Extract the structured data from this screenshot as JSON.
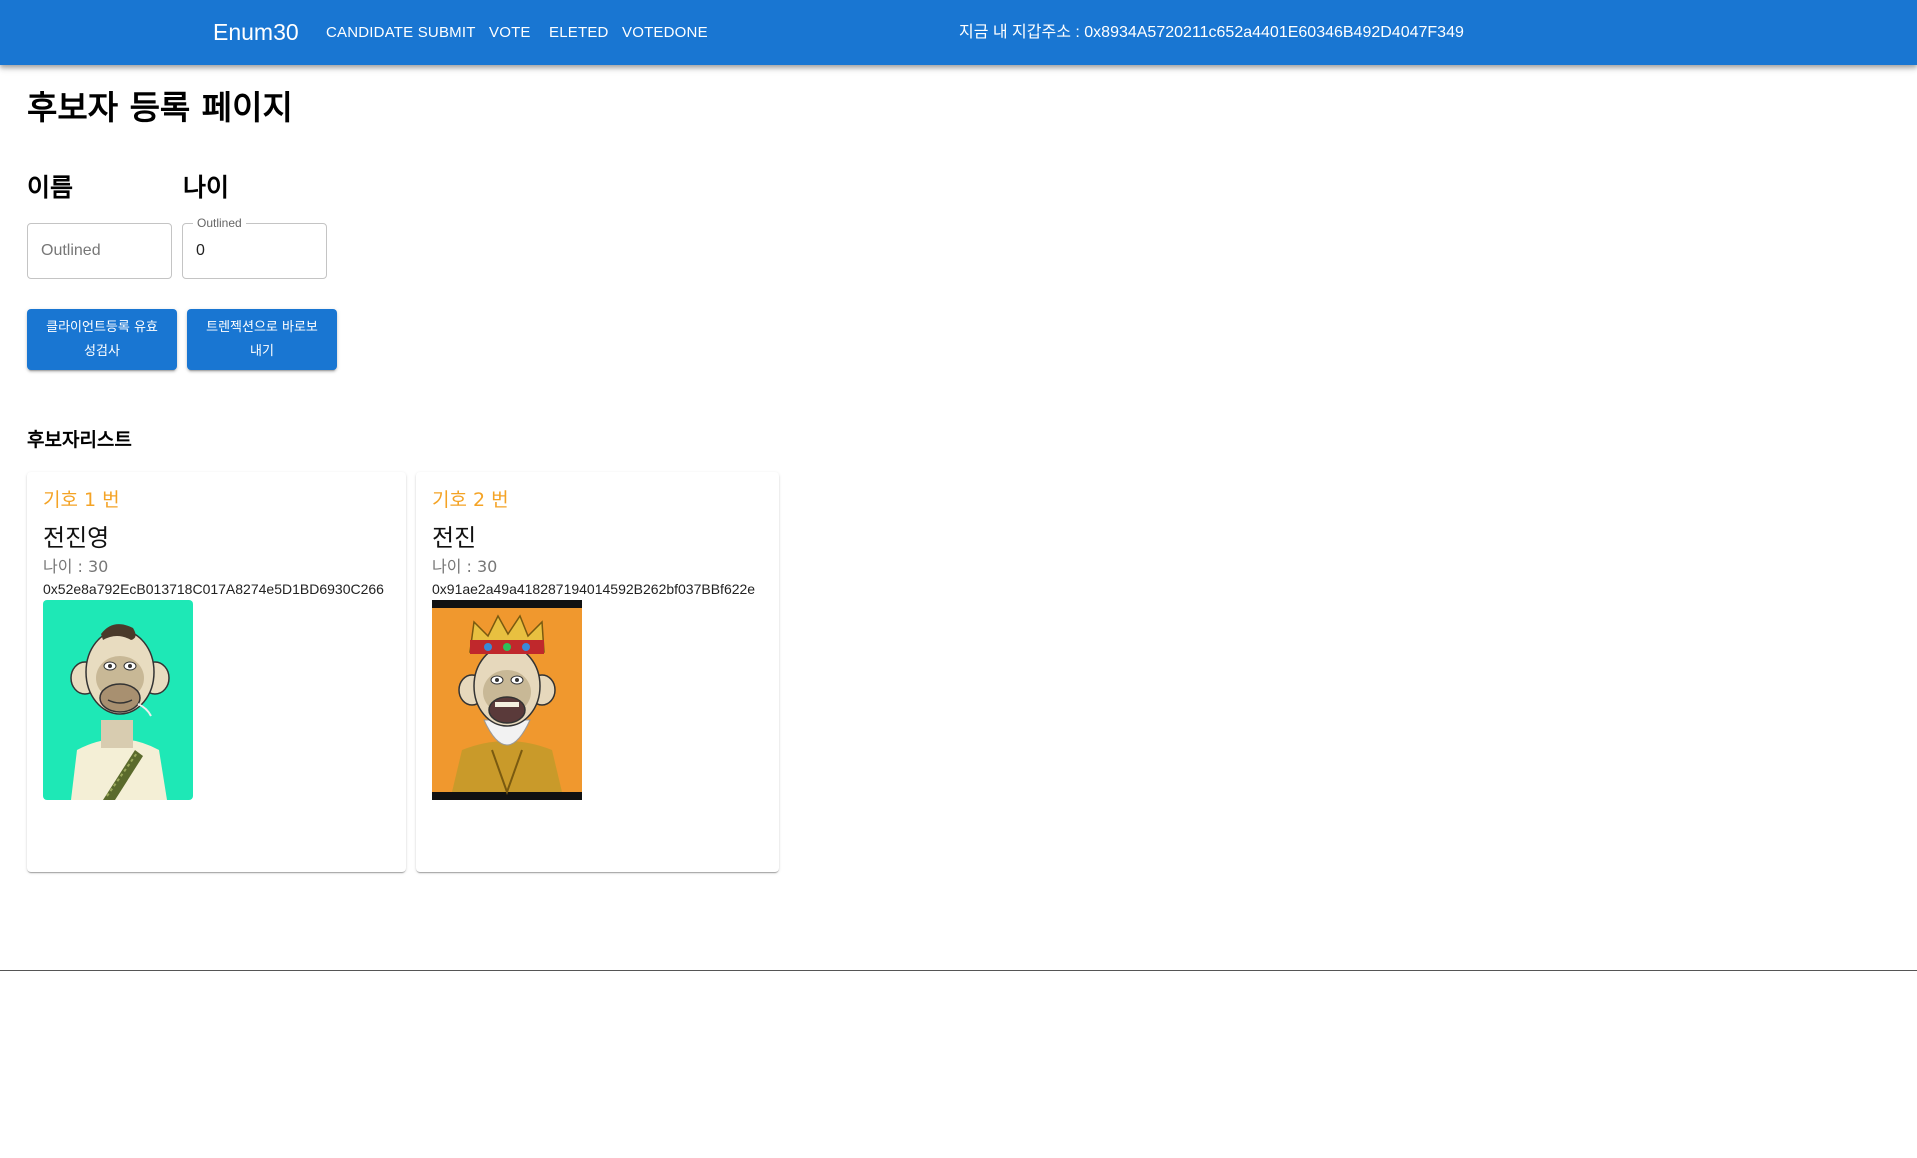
{
  "appbar": {
    "brand": "Enum30",
    "nav": [
      {
        "label": "CANDIDATE SUBMIT"
      },
      {
        "label": "VOTE"
      },
      {
        "label": "ELETED"
      },
      {
        "label": "VOTEDONE"
      }
    ],
    "wallet_text": "지금 내 지갑주소 : 0x8934A5720211c652a4401E60346B492D4047F349",
    "color": "#1976d2"
  },
  "page": {
    "title": "후보자 등록 페이지"
  },
  "form": {
    "name_label": "이름",
    "age_label": "나이",
    "name_input": {
      "placeholder": "Outlined",
      "value": ""
    },
    "age_input": {
      "floating_label": "Outlined",
      "value": "0"
    },
    "validate_button": "클라이언트등록 유효성검사",
    "send_button": "트렌젝션으로 바로보내기"
  },
  "candidates": {
    "title": "후보자리스트",
    "items": [
      {
        "number": "기호 1 번",
        "name": "전진영",
        "age": "나이 : 30",
        "address": "0x52e8a792EcB013718C017A8274e5D1BD6930C266",
        "image": "green-ape-nft-icon"
      },
      {
        "number": "기호 2 번",
        "name": "전진",
        "age": "나이 : 30",
        "address": "0x91ae2a49a418287194014592B262bf037BBf622e",
        "image": "crowned-ape-nft-icon"
      }
    ]
  },
  "colors": {
    "accent": "#1976d2",
    "number_orange": "#f4a325"
  }
}
